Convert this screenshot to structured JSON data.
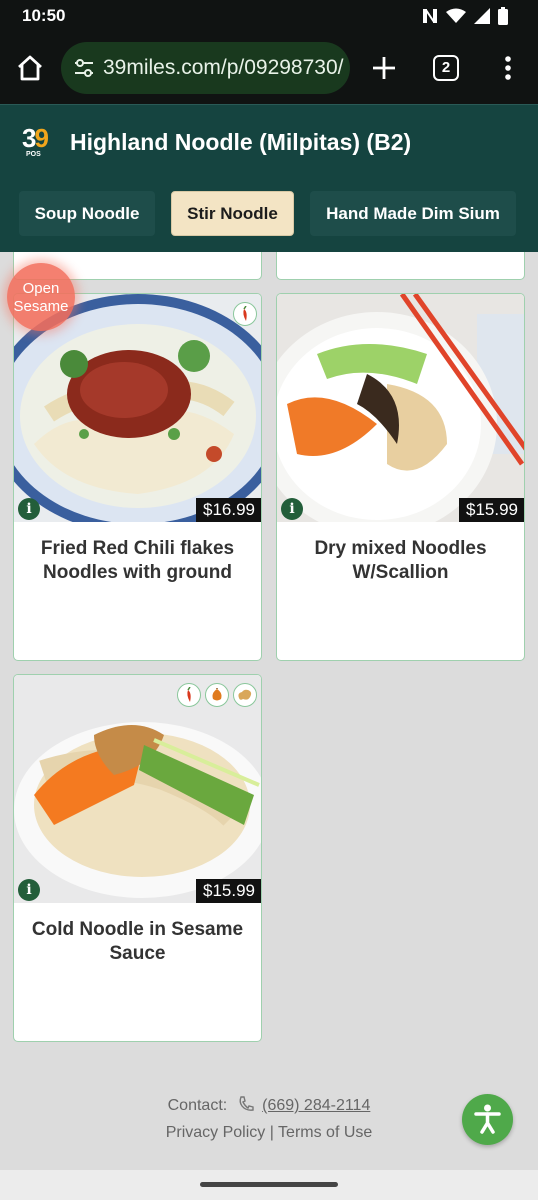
{
  "status_bar": {
    "time": "10:50"
  },
  "browser": {
    "url": "39miles.com/p/09298730/",
    "tab_count": "2"
  },
  "header": {
    "logo_text": "39",
    "logo_sub": "POS",
    "store_title": "Highland Noodle (Milpitas) (B2)",
    "colors": {
      "header_bg": "#154440",
      "active_tab_bg": "#f3e4c4",
      "tab_bg": "#1e4d4a"
    }
  },
  "categories": [
    {
      "label": "Soup Noodle",
      "active": false
    },
    {
      "label": "Stir Noodle",
      "active": true
    },
    {
      "label": "Hand Made Dim Sium",
      "active": false
    }
  ],
  "open_sesame": {
    "label": "Open Sesame"
  },
  "items": [
    {
      "name": "Fried Red Chili flakes Noodles with ground Pork",
      "price": "$16.99",
      "badges": [
        "chili-pepper-icon"
      ]
    },
    {
      "name": "Dry mixed Noodles W/Scallion",
      "price": "$15.99",
      "badges": []
    },
    {
      "name": "Cold Noodle in Sesame Sauce",
      "price": "$15.99",
      "badges": [
        "chili-pepper-icon",
        "nut-icon",
        "peanut-icon"
      ]
    }
  ],
  "footer": {
    "contact_label": "Contact:",
    "phone": "(669) 284-2114",
    "privacy": "Privacy Policy",
    "separator": "|",
    "terms": "Terms of Use"
  }
}
